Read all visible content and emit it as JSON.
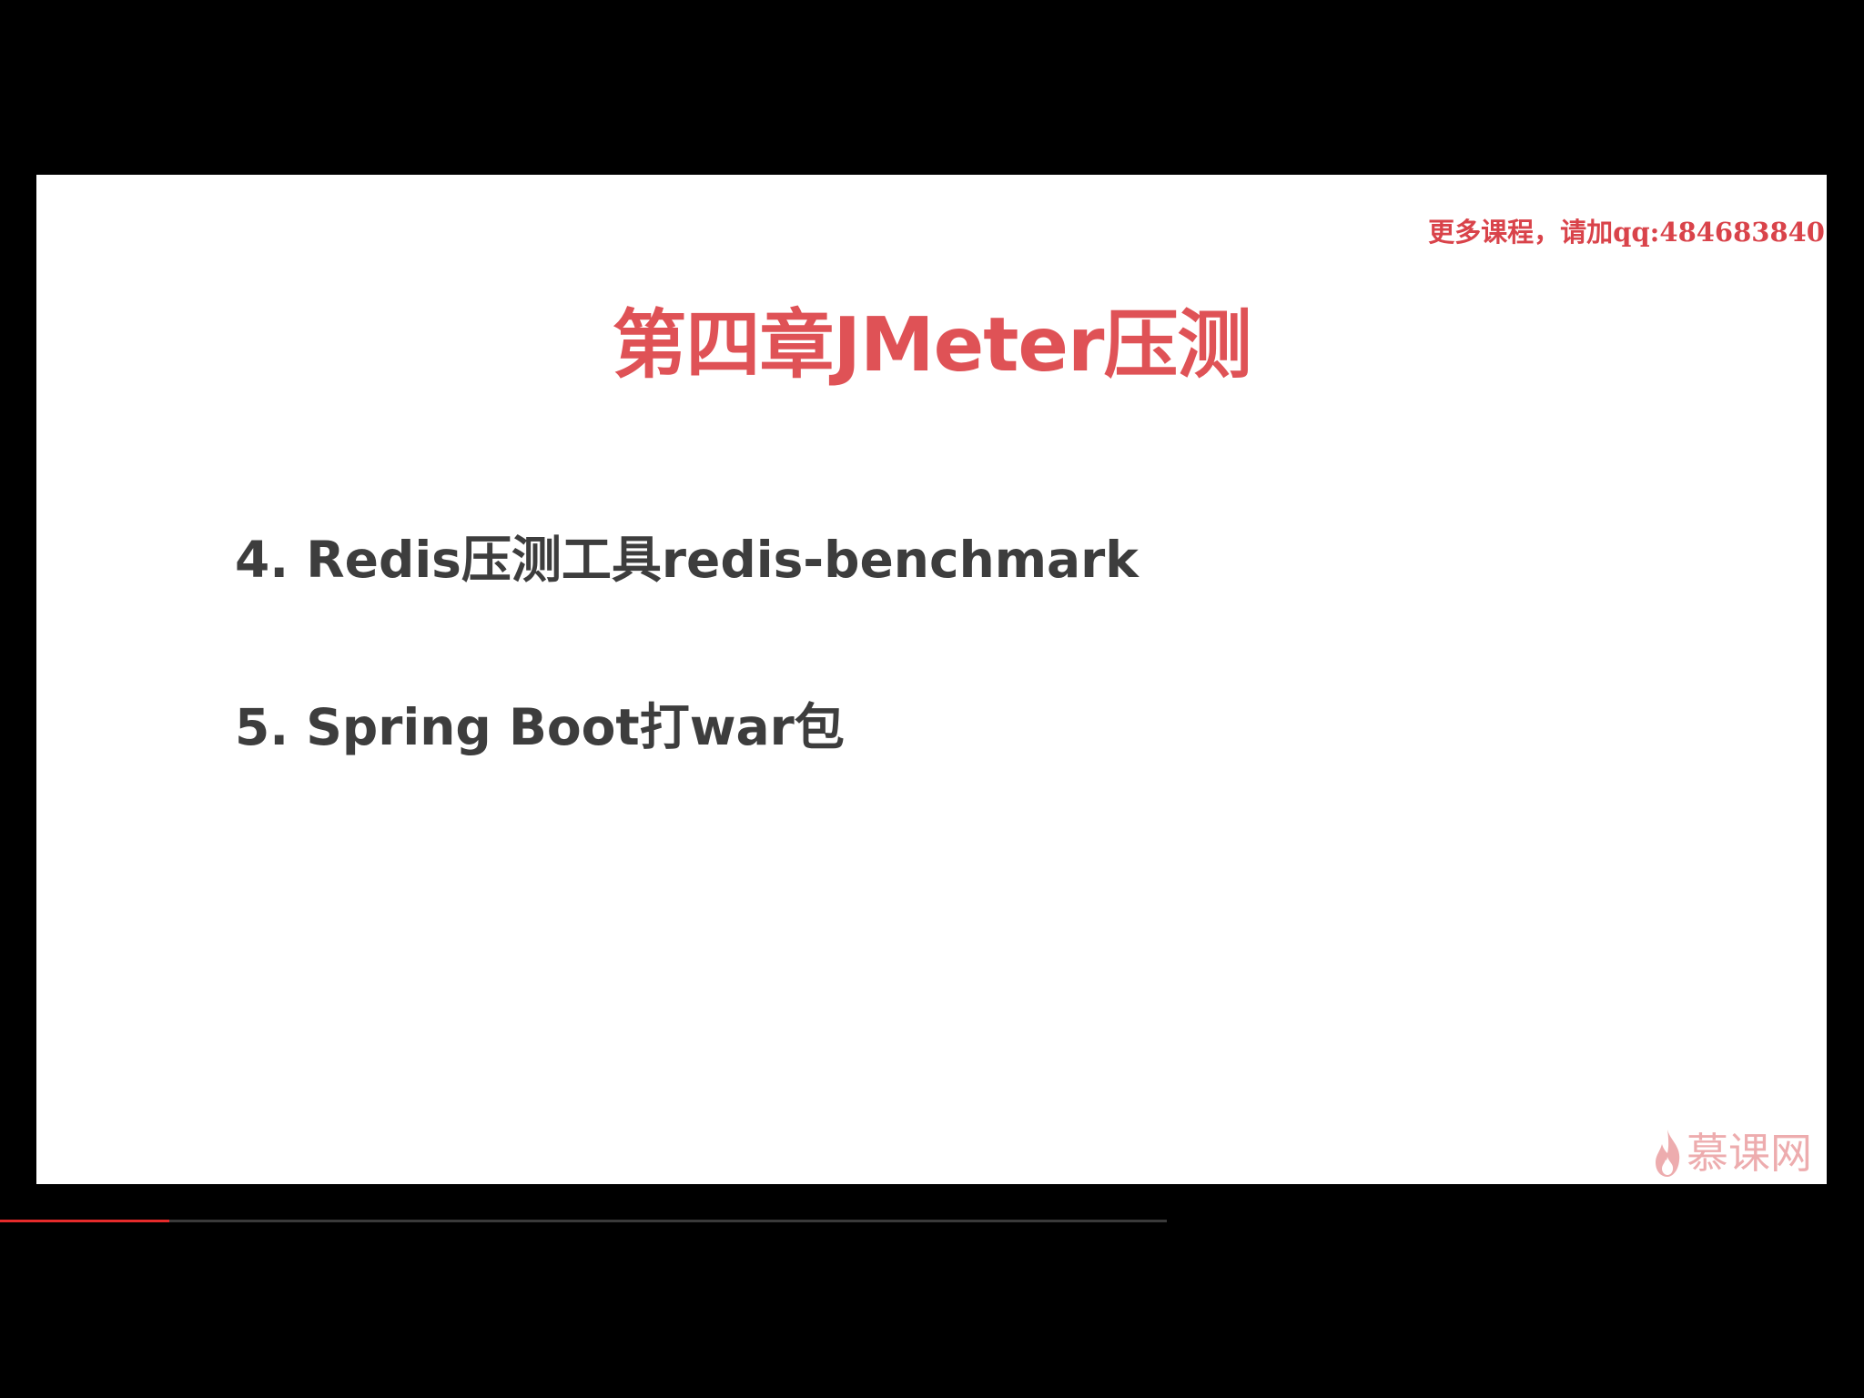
{
  "slide": {
    "watermark": "更多课程，请加qq:484683840",
    "title": "第四章JMeter压测",
    "items": [
      {
        "label": "4. Redis压测工具redis-benchmark"
      },
      {
        "label": "5. Spring Boot打war包"
      }
    ],
    "brand": "慕课网"
  },
  "player": {
    "progress_percent": 14.5,
    "progress_color": "#e52b2b"
  },
  "colors": {
    "title": "#df5256",
    "watermark": "#d9434a",
    "body_text": "#3d3d3d"
  }
}
